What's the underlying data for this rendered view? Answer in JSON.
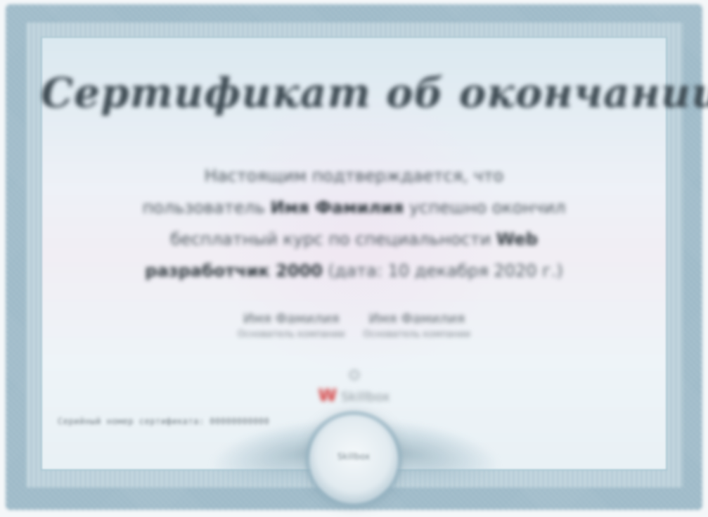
{
  "certificate": {
    "title": "Сертификат об окончании",
    "body_lines": [
      {
        "parts": [
          {
            "text": "Настоящим подтверждается, что",
            "bold": false
          }
        ]
      },
      {
        "parts": [
          {
            "text": "пользователь ",
            "bold": false
          },
          {
            "text": "Имя Фамилия",
            "bold": true
          },
          {
            "text": " успешно окончил",
            "bold": false
          }
        ]
      },
      {
        "parts": [
          {
            "text": "бесплатный курс по специальности ",
            "bold": false
          },
          {
            "text": "Web",
            "bold": true
          }
        ]
      },
      {
        "parts": [
          {
            "text": "разработчик 2000",
            "bold": true
          },
          {
            "text": " (дата: 10 декабря 2020 г.)",
            "bold": false
          }
        ]
      }
    ],
    "signatures": [
      {
        "name": "Имя Фамилия",
        "role": "Основатель компании"
      },
      {
        "name": "Имя Фамилия",
        "role": "Основатель компании"
      }
    ],
    "logo": {
      "mark": "W",
      "text": "Skillbox"
    },
    "serial": "Серийный номер сертификата: 00000000000",
    "seal_text": "Skillbox"
  },
  "colors": {
    "frame": "#a9c2cf",
    "title": "#3d4a52",
    "logo_accent": "#d43a3a"
  }
}
